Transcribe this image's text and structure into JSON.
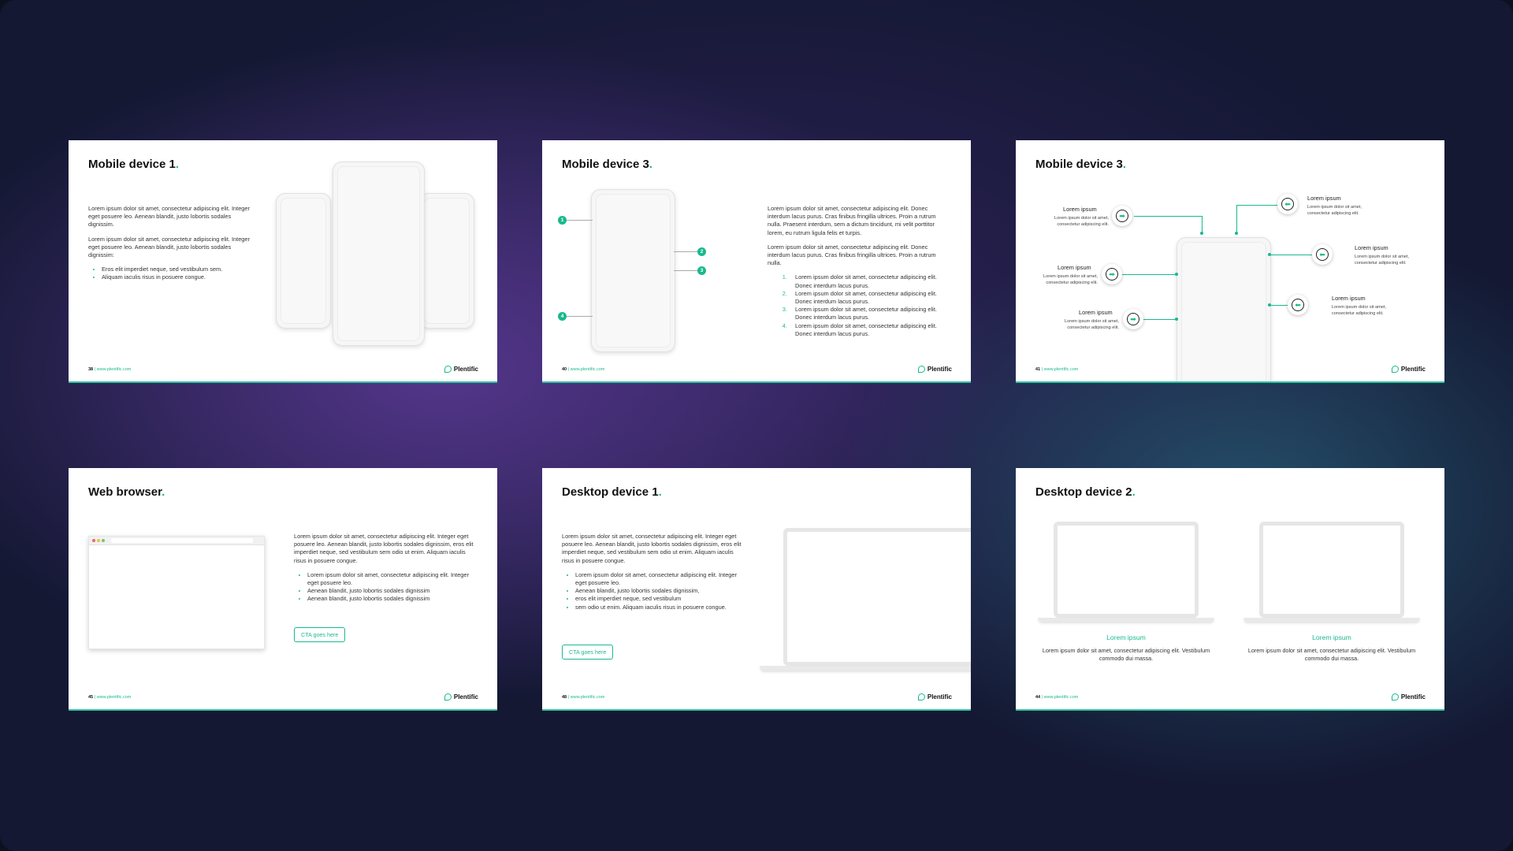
{
  "brand": {
    "name": "Plentific",
    "url": "www.plentific.com",
    "accent": "#18b98f"
  },
  "slides": {
    "s1": {
      "title": "Mobile device 1",
      "dot": ".",
      "page": "38",
      "p1": "Lorem ipsum dolor sit amet, consectetur adipiscing elit. Integer eget posuere leo. Aenean blandit, justo lobortis sodales dignissim.",
      "p2": "Lorem ipsum dolor sit amet, consectetur adipiscing elit. Integer eget posuere leo. Aenean blandit, justo lobortis sodales dignissim:",
      "bullets": [
        "Eros elit imperdiet neque, sed vestibulum sem.",
        "Aliquam iaculis risus in posuere congue."
      ]
    },
    "s2": {
      "title": "Mobile device 3",
      "dot": ".",
      "page": "40",
      "markers": [
        "1",
        "2",
        "3",
        "4"
      ],
      "p1": "Lorem ipsum dolor sit amet, consectetur adipiscing elit. Donec interdum lacus purus. Cras finibus fringilla ultrices. Proin a rutrum nulla. Praesent interdum, sem a dictum tincidunt, mi velit porttitor lorem, eu rutrum ligula felis et turpis.",
      "p2": "Lorem ipsum dolor sit amet, consectetur adipiscing elit. Donec interdum lacus purus. Cras finibus fringilla ultrices. Proin a rutrum nulla.",
      "list": [
        "Lorem ipsum dolor sit amet, consectetur adipiscing elit. Donec interdum lacus purus.",
        "Lorem ipsum dolor sit amet, consectetur adipiscing elit. Donec interdum lacus purus.",
        "Lorem ipsum dolor sit amet, consectetur adipiscing elit. Donec interdum lacus purus.",
        "Lorem ipsum dolor sit amet, consectetur adipiscing elit. Donec interdum lacus purus."
      ]
    },
    "s3": {
      "title": "Mobile device 3",
      "dot": ".",
      "page": "41",
      "callouts": [
        {
          "title": "Lorem ipsum",
          "desc": "Lorem ipsum dolor sit amet, consectetur adipiscing elit."
        },
        {
          "title": "Lorem ipsum",
          "desc": "Lorem ipsum dolor sit amet, consectetur adipiscing elit."
        },
        {
          "title": "Lorem ipsum",
          "desc": "Lorem ipsum dolor sit amet, consectetur adipiscing elit."
        },
        {
          "title": "Lorem ipsum",
          "desc": "Lorem ipsum dolor sit amet, consectetur adipiscing elit."
        },
        {
          "title": "Lorem ipsum",
          "desc": "Lorem ipsum dolor sit amet, consectetur adipiscing elit."
        },
        {
          "title": "Lorem ipsum",
          "desc": "Lorem ipsum dolor sit amet, consectetur adipiscing elit."
        }
      ]
    },
    "s4": {
      "title": "Web browser",
      "dot": ".",
      "page": "45",
      "p1": "Lorem ipsum dolor sit amet, consectetur adipiscing elit. Integer eget posuere leo. Aenean blandit, justo lobortis sodales dignissim, eros elit imperdiet neque, sed vestibulum sem odio ut enim. Aliquam iaculis risus in posuere congue.",
      "bullets": [
        "Lorem ipsum dolor sit amet, consectetur adipiscing elit. Integer eget posuere leo.",
        "Aenean blandit, justo lobortis sodales dignissim",
        "Aenean blandit, justo lobortis sodales dignissim"
      ],
      "cta": "CTA goes here"
    },
    "s5": {
      "title": "Desktop device 1",
      "dot": ".",
      "page": "48",
      "p1": "Lorem ipsum dolor sit amet, consectetur adipiscing elit. Integer eget posuere leo. Aenean blandit, justo lobortis sodales dignissim, eros elit imperdiet neque, sed vestibulum sem odio ut enim. Aliquam iaculis risus in posuere congue.",
      "bullets": [
        "Lorem ipsum dolor sit amet, consectetur adipiscing elit. Integer eget posuere leo.",
        "Aenean blandit, justo lobortis sodales dignissim,",
        "eros elit imperdiet neque, sed vestibulum",
        "sem odio ut enim. Aliquam iaculis risus in posuere congue."
      ],
      "cta": "CTA goes here"
    },
    "s6": {
      "title": "Desktop device 2",
      "dot": ".",
      "page": "44",
      "items": [
        {
          "label": "Lorem ipsum",
          "desc": "Lorem ipsum dolor sit amet, consectetur adipiscing elit. Vestibulum commodo dui massa."
        },
        {
          "label": "Lorem ipsum",
          "desc": "Lorem ipsum dolor sit amet, consectetur adipiscing elit. Vestibulum commodo dui massa."
        }
      ]
    }
  }
}
